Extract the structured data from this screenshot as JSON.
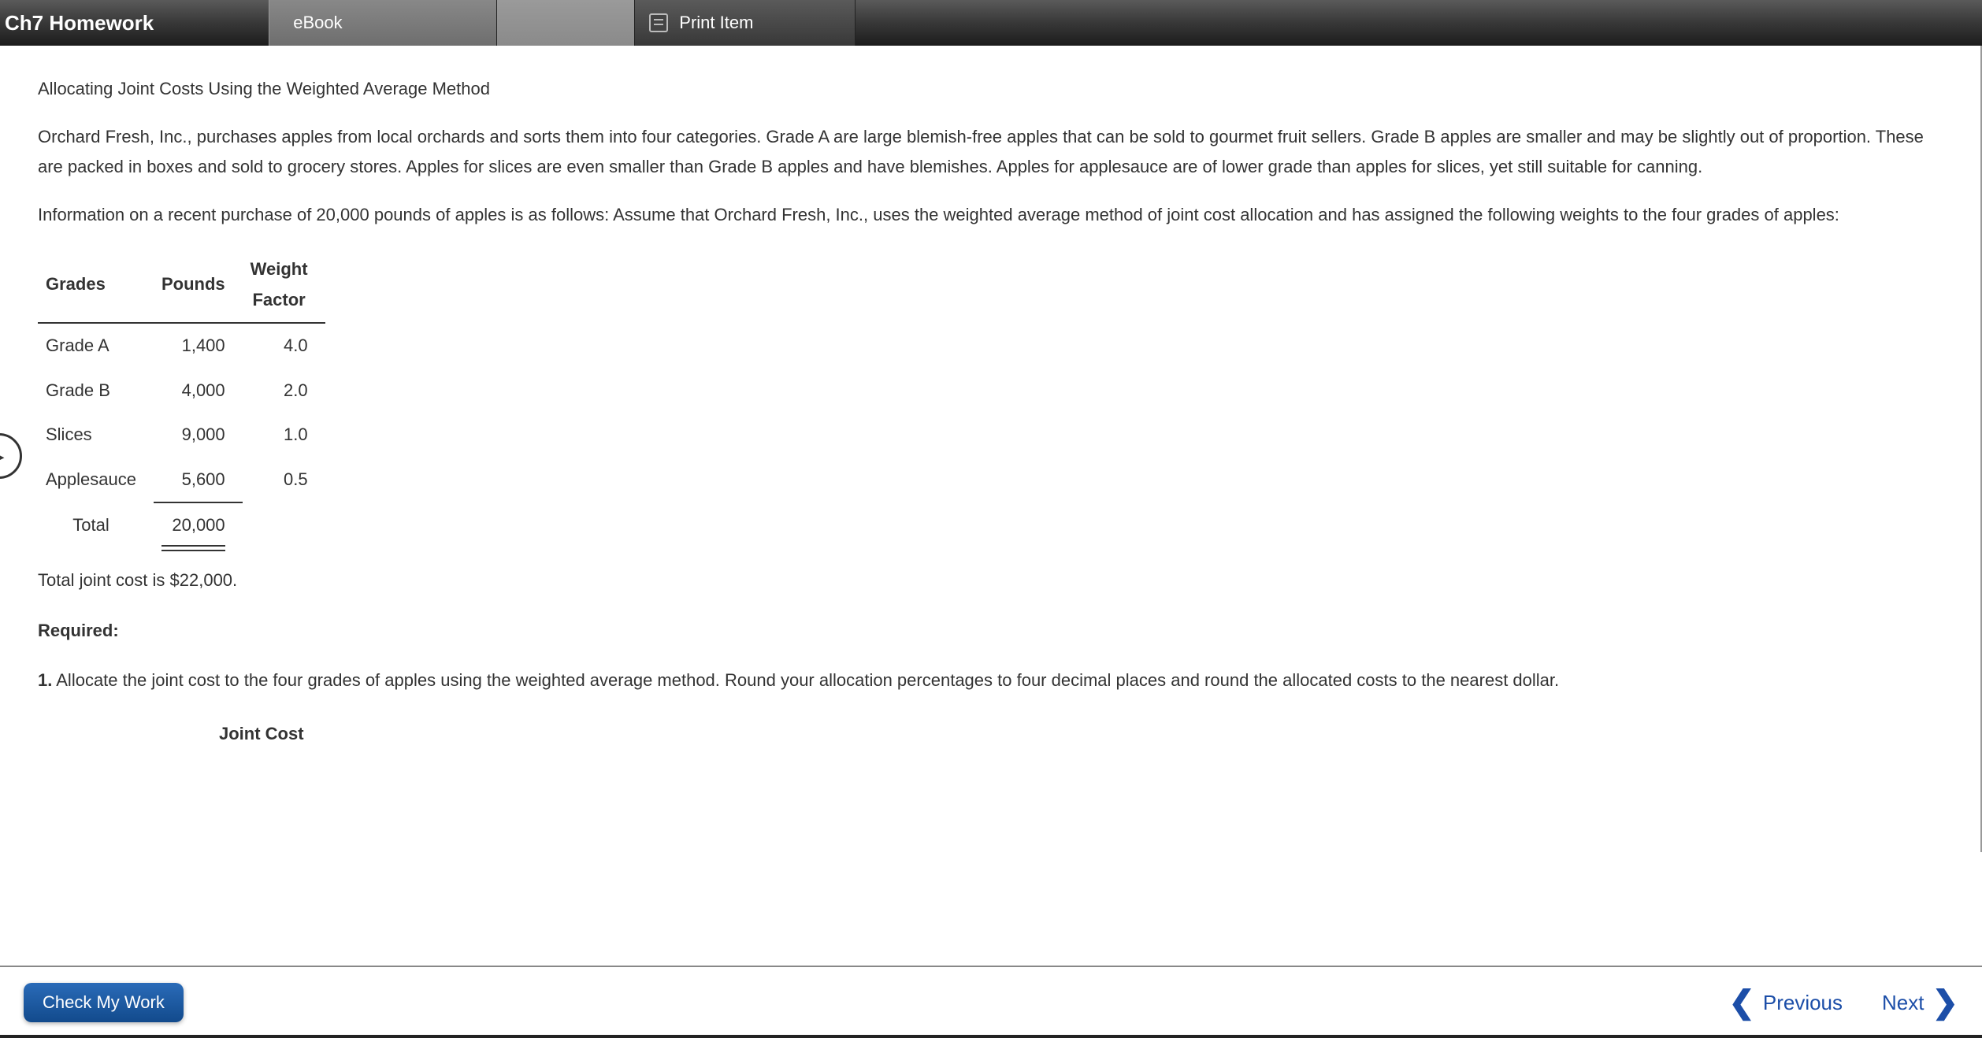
{
  "header": {
    "title": "Ch7 Homework",
    "ebook_label": "eBook",
    "print_label": "Print Item"
  },
  "content": {
    "heading": "Allocating Joint Costs Using the Weighted Average Method",
    "p1": "Orchard Fresh, Inc., purchases apples from local orchards and sorts them into four categories. Grade A are large blemish-free apples that can be sold to gourmet fruit sellers. Grade B apples are smaller and may be slightly out of proportion. These are packed in boxes and sold to grocery stores. Apples for slices are even smaller than Grade B apples and have blemishes. Apples for applesauce are of lower grade than apples for slices, yet still suitable for canning.",
    "p2": "Information on a recent purchase of 20,000 pounds of apples is as follows: Assume that Orchard Fresh, Inc., uses the weighted average method of joint cost allocation and has assigned the following weights to the four grades of apples:",
    "table": {
      "cols": {
        "c1": "Grades",
        "c2": "Pounds",
        "c3": "Weight Factor"
      },
      "rows": [
        {
          "grade": "Grade A",
          "pounds": "1,400",
          "factor": "4.0"
        },
        {
          "grade": "Grade B",
          "pounds": "4,000",
          "factor": "2.0"
        },
        {
          "grade": "Slices",
          "pounds": "9,000",
          "factor": "1.0"
        },
        {
          "grade": "Applesauce",
          "pounds": "5,600",
          "factor": "0.5"
        }
      ],
      "total_label": "Total",
      "total_pounds": "20,000"
    },
    "total_cost": "Total joint cost is $22,000.",
    "required_label": "Required:",
    "q1_num": "1.",
    "q1_text": " Allocate the joint cost to the four grades of apples using the weighted average method. Round your allocation percentages to four decimal places and round the allocated costs to the nearest dollar.",
    "subhead": "Joint Cost"
  },
  "footer": {
    "check_label": "Check My Work",
    "prev_label": "Previous",
    "next_label": "Next"
  }
}
